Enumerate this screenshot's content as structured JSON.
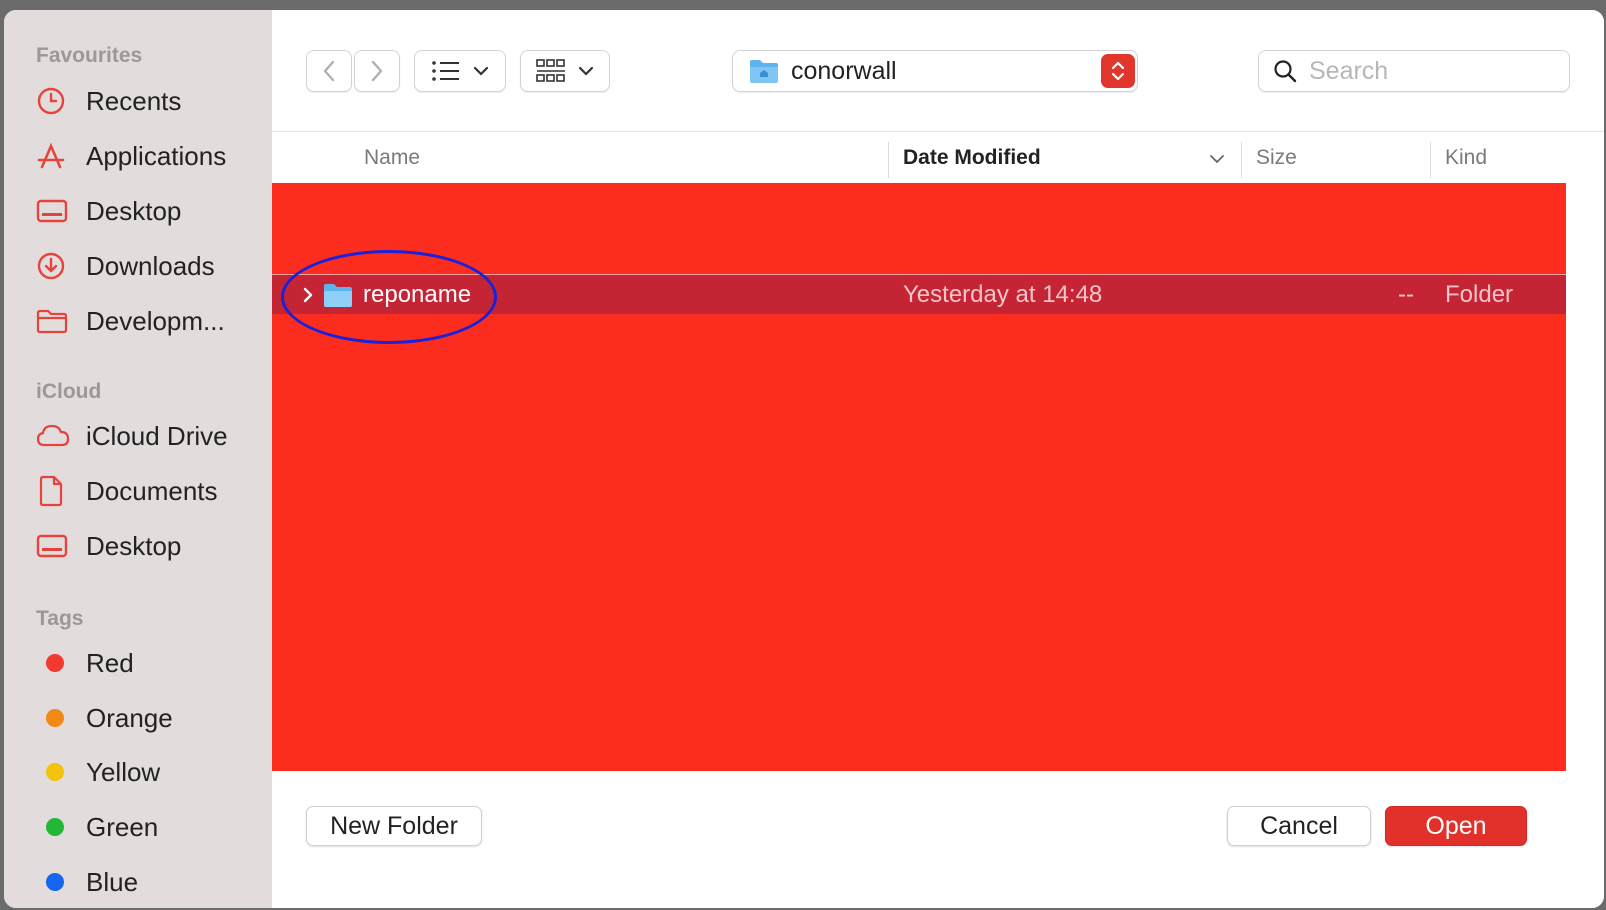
{
  "sidebar": {
    "favourites_title": "Favourites",
    "favourites": [
      {
        "label": "Recents",
        "icon": "clock-icon"
      },
      {
        "label": "Applications",
        "icon": "applications-icon"
      },
      {
        "label": "Desktop",
        "icon": "desktop-icon"
      },
      {
        "label": "Downloads",
        "icon": "download-icon"
      },
      {
        "label": "Developm...",
        "icon": "folder-icon"
      }
    ],
    "icloud_title": "iCloud",
    "icloud": [
      {
        "label": "iCloud Drive",
        "icon": "cloud-icon"
      },
      {
        "label": "Documents",
        "icon": "document-icon"
      },
      {
        "label": "Desktop",
        "icon": "desktop-icon"
      }
    ],
    "tags_title": "Tags",
    "tags": [
      {
        "label": "Red",
        "color": "#f23a2f"
      },
      {
        "label": "Orange",
        "color": "#f08a14"
      },
      {
        "label": "Yellow",
        "color": "#f2c20c"
      },
      {
        "label": "Green",
        "color": "#22b734"
      },
      {
        "label": "Blue",
        "color": "#1466f0"
      }
    ],
    "accent_color": "#e5443c"
  },
  "toolbar": {
    "back_icon": "chevron-left-icon",
    "forward_icon": "chevron-right-icon",
    "list_view_icon": "list-icon",
    "group_icon": "grid-icon",
    "location": "conorwall",
    "search_placeholder": "Search"
  },
  "columns": {
    "name": "Name",
    "date_modified": "Date Modified",
    "size": "Size",
    "kind": "Kind"
  },
  "rows": [
    {
      "name": "reponame",
      "date": "Yesterday at 14:48",
      "size": "--",
      "kind": "Folder"
    }
  ],
  "buttons": {
    "new_folder": "New Folder",
    "cancel": "Cancel",
    "open": "Open"
  },
  "colors": {
    "list_background": "#fc2c1f",
    "selected_row": "#c42433",
    "annotation_ellipse": "#1a22d9"
  }
}
